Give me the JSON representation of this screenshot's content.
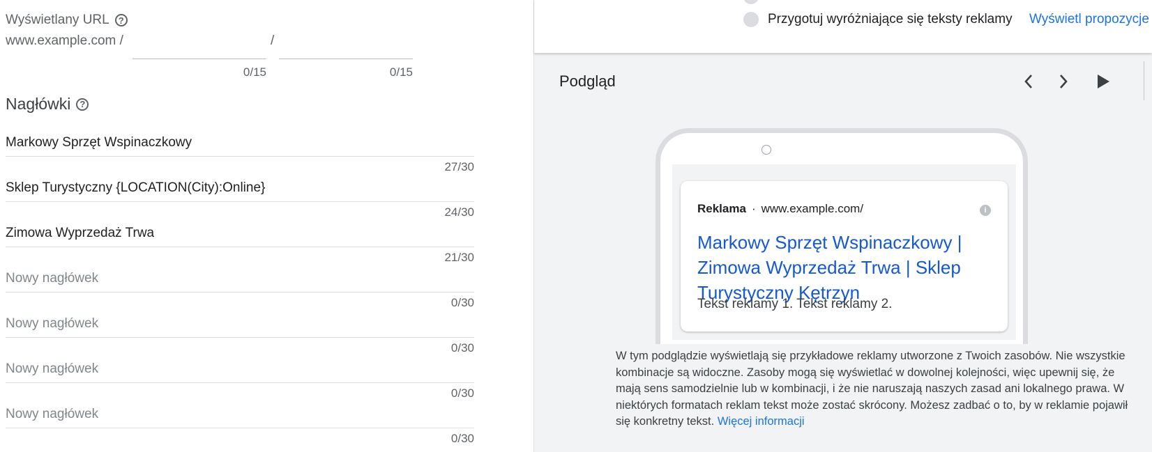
{
  "display_url": {
    "label": "Wyświetlany URL",
    "help_icon": "help-circle-icon",
    "prefix": "www.example.com /",
    "separator": "/",
    "path1_count": "0/15",
    "path2_count": "0/15"
  },
  "headlines": {
    "title": "Nagłówki",
    "help_icon": "help-circle-icon",
    "items": [
      {
        "value": "Markowy Sprzęt Wspinaczkowy",
        "placeholder": "",
        "count": "27/30"
      },
      {
        "value": "Sklep Turystyczny {LOCATION(City):Online}",
        "placeholder": "",
        "count": "24/30"
      },
      {
        "value": "Zimowa Wyprzedaż Trwa",
        "placeholder": "",
        "count": "21/30"
      },
      {
        "value": "",
        "placeholder": "Nowy nagłówek",
        "count": "0/30"
      },
      {
        "value": "",
        "placeholder": "Nowy nagłówek",
        "count": "0/30"
      },
      {
        "value": "",
        "placeholder": "Nowy nagłówek",
        "count": "0/30"
      },
      {
        "value": "",
        "placeholder": "Nowy nagłówek",
        "count": "0/30"
      }
    ]
  },
  "suggestions": {
    "item_text": "Przygotuj wyróżniające się teksty reklamy",
    "item_link": "Wyświetl propozycje"
  },
  "preview": {
    "title": "Podgląd",
    "prev_icon": "chevron-left-icon",
    "next_icon": "chevron-right-icon",
    "play_icon": "play-icon",
    "ad": {
      "badge": "Reklama",
      "separator": "·",
      "url": "www.example.com/",
      "info_icon": "info-icon",
      "headline": "Markowy Sprzęt Wspinaczkowy | Zimowa Wyprzedaż Trwa | Sklep Turystyczny Kętrzyn",
      "description": "Tekst reklamy 1. Tekst reklamy 2."
    },
    "note": "W tym podglądzie wyświetlają się przykładowe reklamy utworzone z Twoich zasobów. Nie wszystkie kombinacje są widoczne. Zasoby mogą się wyświetlać w dowolnej kolejności, więc upewnij się, że mają sens samodzielnie lub w kombinacji, i że nie naruszają naszych zasad ani lokalnego prawa. W niektórych formatach reklam tekst może zostać skrócony. Możesz zadbać o to, by w reklamie pojawił się konkretny tekst.",
    "more_link": "Więcej informacji"
  },
  "colors": {
    "link": "#1a73e8",
    "ad_headline": "#1558d6",
    "panel_bg": "#f1f3f4"
  }
}
